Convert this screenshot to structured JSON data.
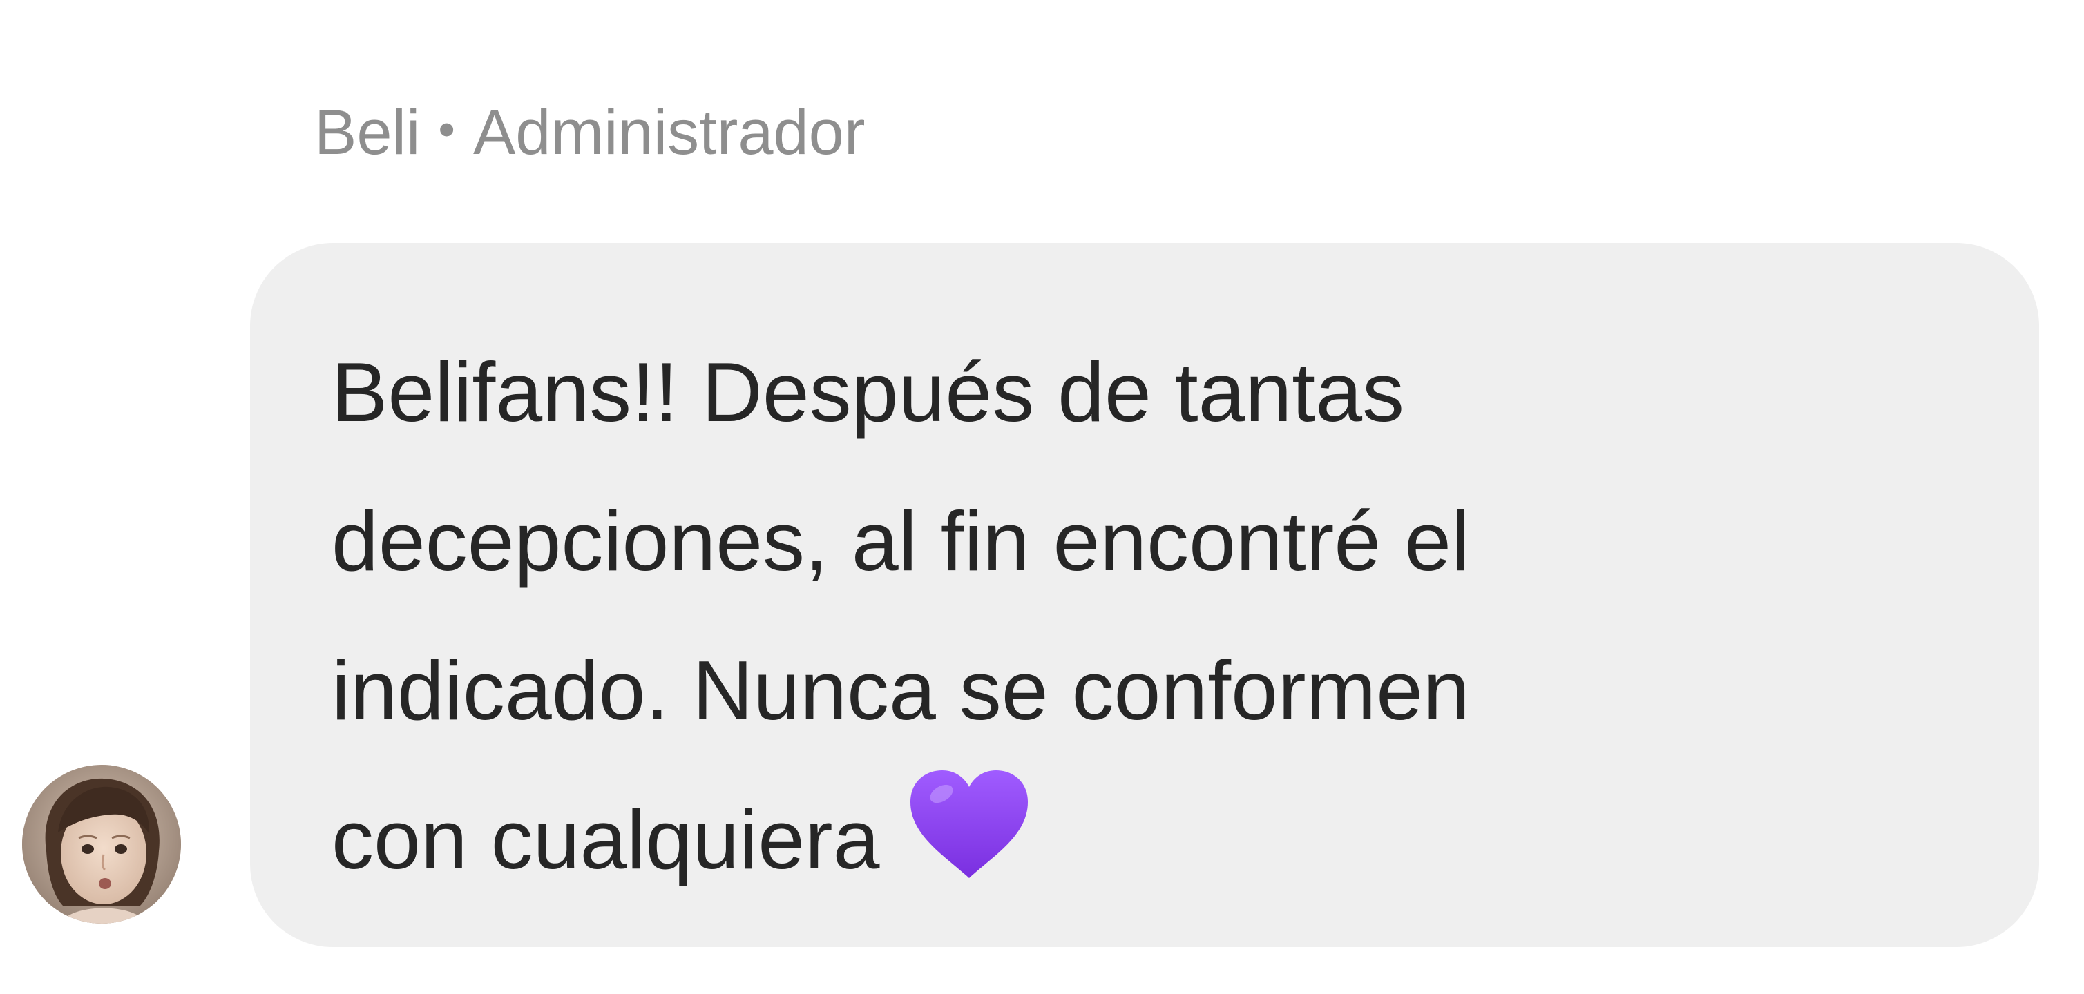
{
  "sender": {
    "name": "Beli",
    "separator": "•",
    "role": "Administrador"
  },
  "avatar": {
    "icon": "child-portrait-avatar"
  },
  "message": {
    "lines": [
      "Belifans!! Después de tantas",
      "decepciones, al fin encontré el",
      "indicado. Nunca se conformen",
      "con cualquiera"
    ],
    "emoji": "purple-heart-icon",
    "emoji_color": "#8a3ff0",
    "bubble_color": "#efefef"
  }
}
